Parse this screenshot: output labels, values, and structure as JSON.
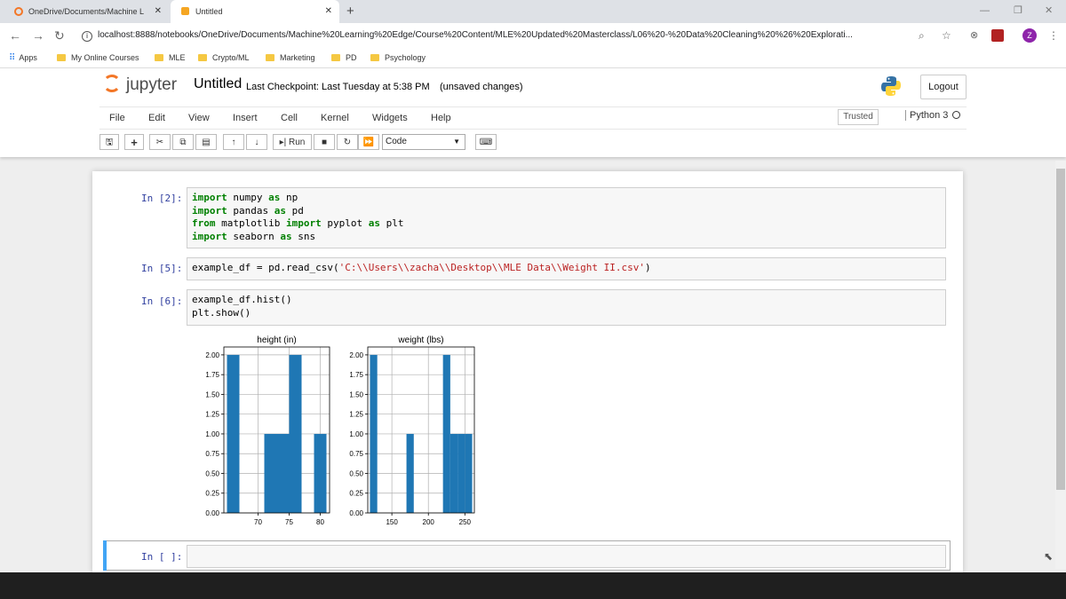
{
  "browser": {
    "tabs": [
      {
        "title": "OneDrive/Documents/Machine L",
        "close": "✕"
      },
      {
        "title": "Untitled",
        "close": "✕"
      }
    ],
    "new_tab": "+",
    "window_controls": {
      "minimize": "—",
      "restore": "❐",
      "close": "✕"
    },
    "url": "localhost:8888/notebooks/OneDrive/Documents/Machine%20Learning%20Edge/Course%20Content/MLE%20Updated%20Masterclass/L06%20-%20Data%20Cleaning%20%26%20Explorati...",
    "profile_initial": "Z",
    "bookmarks": [
      "Apps",
      "My Online Courses",
      "MLE",
      "Crypto/ML",
      "Marketing",
      "PD",
      "Psychology"
    ]
  },
  "jupyter": {
    "logo_text": "jupyter",
    "notebook_title": "Untitled",
    "checkpoint": "Last Checkpoint: Last Tuesday at 5:38 PM",
    "unsaved": "(unsaved changes)",
    "logout": "Logout",
    "menu": [
      "File",
      "Edit",
      "View",
      "Insert",
      "Cell",
      "Kernel",
      "Widgets",
      "Help"
    ],
    "trusted": "Trusted",
    "kernel_name": "Python 3",
    "toolbar": {
      "run_label": "Run",
      "cell_type": "Code"
    }
  },
  "cells": [
    {
      "prompt": "In [2]:",
      "lines": [
        [
          {
            "t": "import",
            "c": "kw"
          },
          {
            "t": " numpy ",
            "c": ""
          },
          {
            "t": "as",
            "c": "kw"
          },
          {
            "t": " np",
            "c": ""
          }
        ],
        [
          {
            "t": "import",
            "c": "kw"
          },
          {
            "t": " pandas ",
            "c": ""
          },
          {
            "t": "as",
            "c": "kw"
          },
          {
            "t": " pd",
            "c": ""
          }
        ],
        [
          {
            "t": "from",
            "c": "kw"
          },
          {
            "t": " matplotlib ",
            "c": ""
          },
          {
            "t": "import",
            "c": "kw"
          },
          {
            "t": " pyplot ",
            "c": ""
          },
          {
            "t": "as",
            "c": "kw"
          },
          {
            "t": " plt",
            "c": ""
          }
        ],
        [
          {
            "t": "import",
            "c": "kw"
          },
          {
            "t": " seaborn ",
            "c": ""
          },
          {
            "t": "as",
            "c": "kw"
          },
          {
            "t": " sns",
            "c": ""
          }
        ]
      ]
    },
    {
      "prompt": "In [5]:",
      "lines": [
        [
          {
            "t": "example_df = pd.read_csv(",
            "c": ""
          },
          {
            "t": "'C:\\\\Users\\\\zacha\\\\Desktop\\\\MLE Data\\\\Weight II.csv'",
            "c": "str"
          },
          {
            "t": ")",
            "c": ""
          }
        ]
      ]
    },
    {
      "prompt": "In [6]:",
      "lines": [
        [
          {
            "t": "example_df.hist()",
            "c": ""
          }
        ],
        [
          {
            "t": "plt.show()",
            "c": ""
          }
        ]
      ]
    },
    {
      "prompt": "In [ ]:",
      "lines": []
    }
  ],
  "chart_data": [
    {
      "type": "bar",
      "title": "height (in)",
      "bins": [
        {
          "start": 65.0,
          "end": 67.0,
          "count": 2
        },
        {
          "start": 67.0,
          "end": 69.0,
          "count": 0
        },
        {
          "start": 69.0,
          "end": 71.0,
          "count": 0
        },
        {
          "start": 71.0,
          "end": 73.0,
          "count": 1
        },
        {
          "start": 73.0,
          "end": 75.0,
          "count": 1
        },
        {
          "start": 75.0,
          "end": 77.0,
          "count": 2
        },
        {
          "start": 77.0,
          "end": 79.0,
          "count": 0
        },
        {
          "start": 79.0,
          "end": 81.0,
          "count": 1
        }
      ],
      "xlim": [
        64.5,
        81.5
      ],
      "xticks": [
        70,
        75,
        80
      ],
      "ylim": [
        0,
        2.1
      ],
      "yticks": [
        "0.00",
        "0.25",
        "0.50",
        "0.75",
        "1.00",
        "1.25",
        "1.50",
        "1.75",
        "2.00"
      ],
      "grid": true,
      "bar_color": "#1f77b4"
    },
    {
      "type": "bar",
      "title": "weight (lbs)",
      "bins": [
        {
          "start": 120,
          "end": 130,
          "count": 2
        },
        {
          "start": 130,
          "end": 140,
          "count": 0
        },
        {
          "start": 140,
          "end": 150,
          "count": 0
        },
        {
          "start": 150,
          "end": 160,
          "count": 0
        },
        {
          "start": 160,
          "end": 170,
          "count": 0
        },
        {
          "start": 170,
          "end": 180,
          "count": 1
        },
        {
          "start": 180,
          "end": 190,
          "count": 0
        },
        {
          "start": 190,
          "end": 200,
          "count": 0
        },
        {
          "start": 200,
          "end": 210,
          "count": 0
        },
        {
          "start": 210,
          "end": 220,
          "count": 0
        },
        {
          "start": 220,
          "end": 230,
          "count": 2
        },
        {
          "start": 230,
          "end": 240,
          "count": 1
        },
        {
          "start": 240,
          "end": 250,
          "count": 1
        },
        {
          "start": 250,
          "end": 260,
          "count": 1
        }
      ],
      "xlim": [
        117,
        263
      ],
      "xticks": [
        150,
        200,
        250
      ],
      "ylim": [
        0,
        2.1
      ],
      "yticks": [
        "0.00",
        "0.25",
        "0.50",
        "0.75",
        "1.00",
        "1.25",
        "1.50",
        "1.75",
        "2.00"
      ],
      "grid": true,
      "bar_color": "#1f77b4"
    }
  ]
}
